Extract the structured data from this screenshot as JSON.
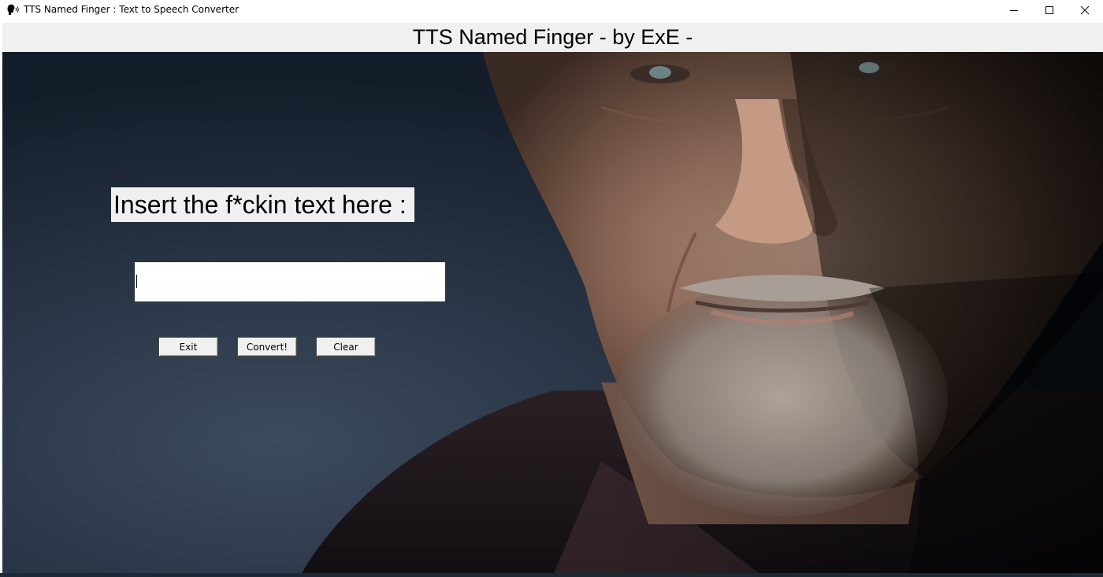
{
  "window": {
    "title": "TTS Named Finger : Text to Speech Converter",
    "icon": "speaking-head-icon",
    "controls": {
      "minimize_icon": "minimize-icon",
      "maximize_icon": "maximize-icon",
      "close_icon": "close-icon"
    }
  },
  "header": {
    "title": "TTS Named Finger - by ExE -"
  },
  "main": {
    "prompt_label": "Insert the f*ckin text here :",
    "text_input": {
      "value": "",
      "placeholder": ""
    },
    "buttons": {
      "exit_label": "Exit",
      "convert_label": "Convert!",
      "clear_label": "Clear"
    }
  },
  "colors": {
    "label_background": "#f0f0f0",
    "canvas_background": "#1e2a3a",
    "button_face": "#f0f0f0"
  }
}
